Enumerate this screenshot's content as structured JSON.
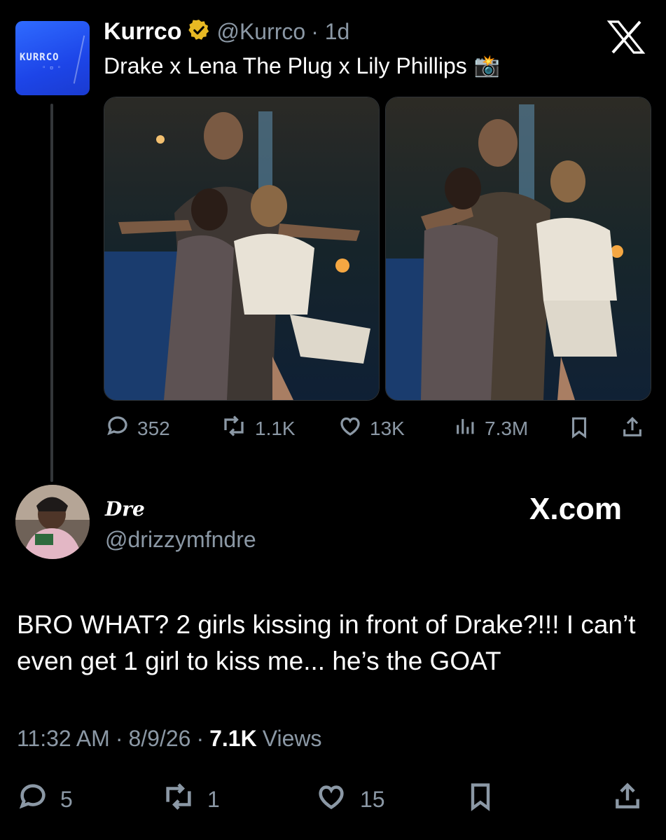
{
  "quoted_tweet": {
    "author_name": "Kurrco",
    "handle": "@Kurrco",
    "age": "· 1d",
    "text": "Drake x Lena The Plug x Lily Phillips",
    "emoji": "📸",
    "avatar_text": "KURRCO",
    "close_glyph": "X",
    "stats": {
      "replies": "352",
      "reposts": "1.1K",
      "likes": "13K",
      "views": "7.3M"
    }
  },
  "tweet": {
    "author_name": "Dre",
    "handle": "@drizzymfndre",
    "watermark": "X.com",
    "body": "BRO WHAT? 2 girls kissing in front of Drake?!!! I can’t even get 1 girl to kiss me... he’s the GOAT",
    "time": "11:32 AM",
    "date": "8/9/26",
    "views_count": "7.1K",
    "views_label": "Views",
    "stats": {
      "replies": "5",
      "reposts": "1",
      "likes": "15"
    }
  },
  "icons": {
    "verified": "verified-badge-icon",
    "reply": "reply-icon",
    "repost": "repost-icon",
    "like": "like-icon",
    "views": "views-icon",
    "bookmark": "bookmark-icon",
    "share": "share-icon"
  },
  "colors": {
    "background": "#000000",
    "secondary_text": "#8b98a5",
    "verified_gold": "#e8b923",
    "kurrco_blue": "#1d45e8"
  }
}
